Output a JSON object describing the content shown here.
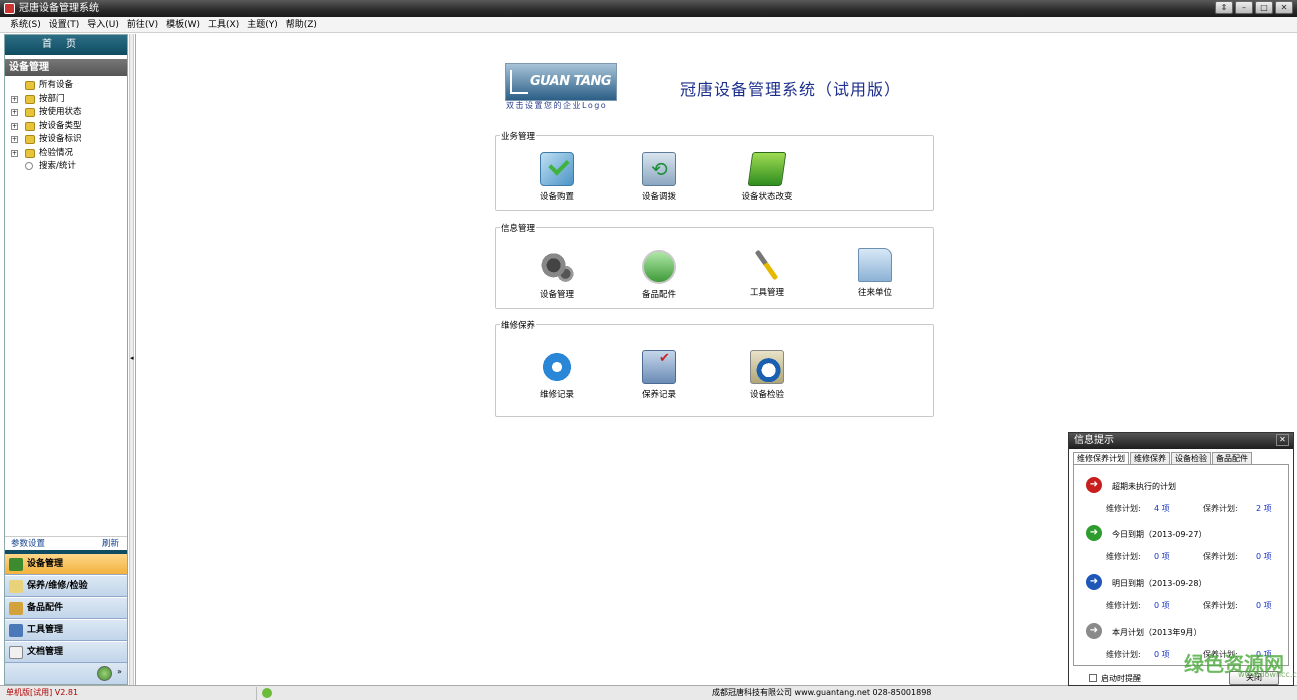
{
  "window": {
    "title": "冠唐设备管理系统"
  },
  "menu": [
    "系统(S)",
    "设置(T)",
    "导入(U)",
    "前往(V)",
    "模板(W)",
    "工具(X)",
    "主题(Y)",
    "帮助(Z)"
  ],
  "sidebar": {
    "home_label": "首页",
    "section_title": "设备管理",
    "tree": [
      {
        "label": "所有设备",
        "icon": "folder-icon",
        "expandable": false
      },
      {
        "label": "按部门",
        "icon": "folder-icon",
        "expandable": true
      },
      {
        "label": "按使用状态",
        "icon": "folder-icon",
        "expandable": true
      },
      {
        "label": "按设备类型",
        "icon": "folder-icon",
        "expandable": true
      },
      {
        "label": "按设备标识",
        "icon": "folder-icon",
        "expandable": true
      },
      {
        "label": "检验情况",
        "icon": "folder-icon",
        "expandable": true
      },
      {
        "label": "搜索/统计",
        "icon": "search-icon",
        "expandable": false
      }
    ],
    "params_label": "参数设置",
    "refresh_label": "刷新",
    "nav": [
      {
        "label": "设备管理",
        "active": true
      },
      {
        "label": "保养/维修/检验",
        "active": false
      },
      {
        "label": "备品配件",
        "active": false
      },
      {
        "label": "工具管理",
        "active": false
      },
      {
        "label": "文档管理",
        "active": false
      }
    ]
  },
  "main": {
    "logo_text": "GUAN TANG",
    "logo_caption": "双击设置您的企业Logo",
    "system_title": "冠唐设备管理系统（试用版）",
    "groups": [
      {
        "title": "业务管理",
        "tiles": [
          {
            "label": "设备购置",
            "icon": "purchase-icon"
          },
          {
            "label": "设备调拨",
            "icon": "transfer-icon"
          },
          {
            "label": "设备状态改变",
            "icon": "status-change-icon"
          }
        ]
      },
      {
        "title": "信息管理",
        "tiles": [
          {
            "label": "设备管理",
            "icon": "gears-icon"
          },
          {
            "label": "备品配件",
            "icon": "parts-icon"
          },
          {
            "label": "工具管理",
            "icon": "screwdriver-icon"
          },
          {
            "label": "往来单位",
            "icon": "folder-icon"
          }
        ]
      },
      {
        "title": "维修保养",
        "tiles": [
          {
            "label": "维修记录",
            "icon": "repair-icon"
          },
          {
            "label": "保养记录",
            "icon": "maintenance-icon"
          },
          {
            "label": "设备检验",
            "icon": "inspection-icon"
          }
        ]
      }
    ]
  },
  "statusbar": {
    "version": "单机版[试用]  V2.81",
    "company": "成都冠唐科技有限公司  www.guantang.net  028-85001898"
  },
  "popup": {
    "title": "信息提示",
    "tabs": [
      "维修保养计划",
      "维修保养",
      "设备检验",
      "备品配件"
    ],
    "items": [
      {
        "title": "超期未执行的计划",
        "color": "#c81e1e",
        "repair_label": "维修计划:",
        "repair_count": "4 项",
        "maint_label": "保养计划:",
        "maint_count": "2 项"
      },
      {
        "title": "今日到期（2013-09-27）",
        "color": "#2e9d2e",
        "repair_label": "维修计划:",
        "repair_count": "0 项",
        "maint_label": "保养计划:",
        "maint_count": "0 项"
      },
      {
        "title": "明日到期（2013-09-28）",
        "color": "#1f57b8",
        "repair_label": "维修计划:",
        "repair_count": "0 项",
        "maint_label": "保养计划:",
        "maint_count": "0 项"
      },
      {
        "title": "本月计划（2013年9月）",
        "color": "#8a8a8a",
        "repair_label": "维修计划:",
        "repair_count": "0 项",
        "maint_label": "保养计划:",
        "maint_count": "0 项"
      }
    ],
    "startup_label": "启动时提醒",
    "close_label": "关闭"
  },
  "watermark": {
    "text": "绿色资源网",
    "sub": "www.downcc.com"
  }
}
